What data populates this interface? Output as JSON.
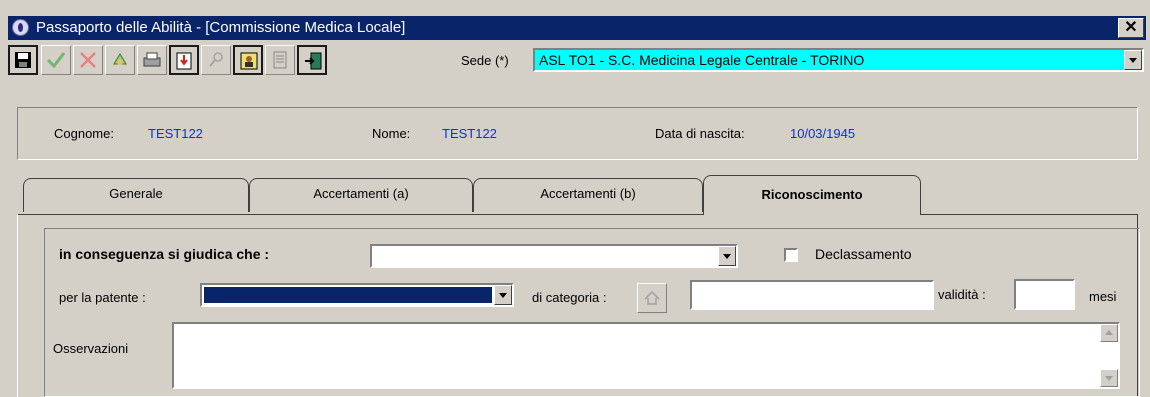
{
  "window": {
    "title": "Passaporto delle Abilità - [Commissione Medica Locale]",
    "close_label": "✕"
  },
  "toolbar": {
    "buttons": [
      {
        "name": "save-icon",
        "enabled": true
      },
      {
        "name": "confirm-check-icon",
        "enabled": true
      },
      {
        "name": "delete-x-icon",
        "enabled": true
      },
      {
        "name": "refresh-icon",
        "enabled": true
      },
      {
        "name": "print-icon",
        "enabled": true
      },
      {
        "name": "import-document-icon",
        "enabled": true
      },
      {
        "name": "search-icon",
        "enabled": false
      },
      {
        "name": "person-card-icon",
        "enabled": true
      },
      {
        "name": "notes-icon",
        "enabled": false
      },
      {
        "name": "exit-door-icon",
        "enabled": true
      }
    ],
    "sede_label": "Sede (*)",
    "sede_value": "ASL TO1 - S.C. Medicina Legale Centrale - TORINO",
    "sede_color": "#00ffff"
  },
  "header": {
    "cognome_label": "Cognome:",
    "cognome_value": "TEST122",
    "nome_label": "Nome:",
    "nome_value": "TEST122",
    "nascita_label": "Data di nascita:",
    "nascita_value": "10/03/1945",
    "value_color": "#1030c8"
  },
  "tabs": [
    {
      "label": "Generale",
      "active": false
    },
    {
      "label": "Accertamenti (a)",
      "active": false
    },
    {
      "label": "Accertamenti (b)",
      "active": false
    },
    {
      "label": "Riconoscimento",
      "active": true
    }
  ],
  "form": {
    "giudica_label": "in conseguenza si giudica che :",
    "giudica_value": "",
    "declassamento_label": "Declassamento",
    "declassamento_checked": false,
    "patente_label": "per la patente :",
    "categoria_label": "di categoria :",
    "categoria_value": "",
    "validita_label": "validità :",
    "validita_value": "",
    "mesi_label": "mesi",
    "osservazioni_label": "Osservazioni",
    "osservazioni_value": ""
  }
}
